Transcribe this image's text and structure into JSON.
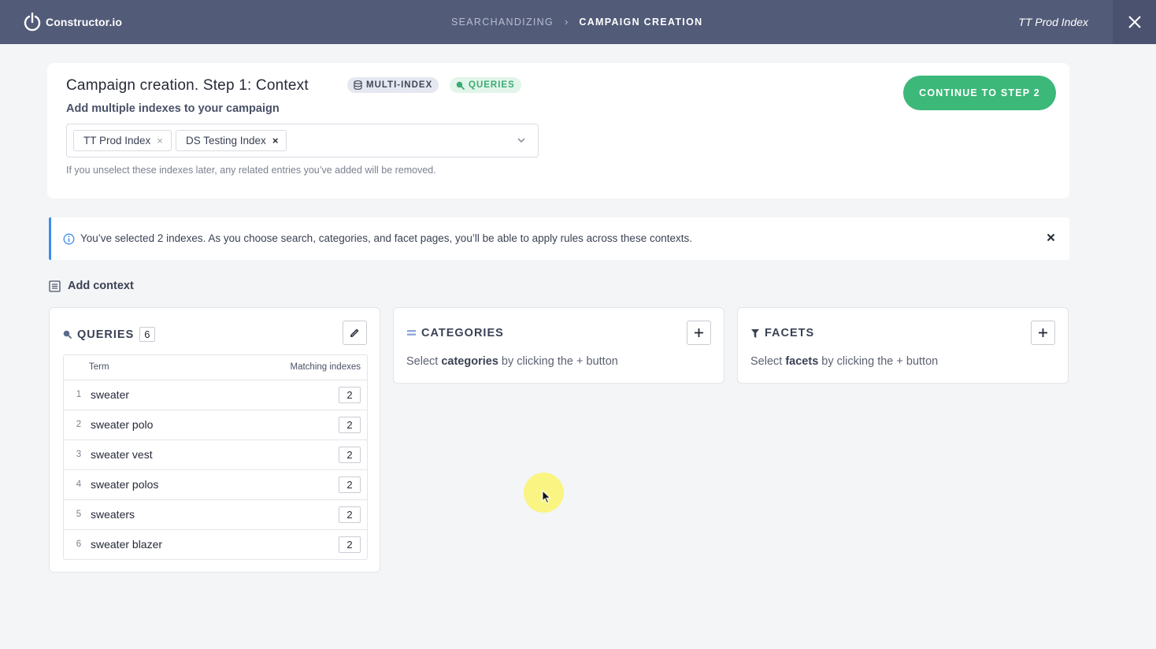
{
  "topbar": {
    "logo_text": "Constructor.io",
    "breadcrumb": [
      "SEARCHANDIZING",
      "CAMPAIGN CREATION"
    ],
    "breadcrumb_sep": "›",
    "index_name": "TT Prod Index"
  },
  "header": {
    "title": "Campaign creation. Step 1: Context",
    "badges": [
      {
        "label": "MULTI-INDEX",
        "icon": "database-icon"
      },
      {
        "label": "QUERIES",
        "icon": "search-icon"
      }
    ],
    "subtitle": "Add multiple indexes to your campaign",
    "selected_indexes": [
      "TT Prod Index",
      "DS Testing Index"
    ],
    "chip_remove": "×",
    "helper_text": "If you unselect these indexes later, any related entries you’ve added will be removed.",
    "continue_label": "CONTINUE TO STEP 2"
  },
  "banner": {
    "text": "You’ve selected 2 indexes. As you choose search, categories, and facet pages, you’ll be able to apply rules across these contexts."
  },
  "add_context": {
    "label": "Add context"
  },
  "queries_panel": {
    "title": "QUERIES",
    "count": "6",
    "columns": {
      "term": "Term",
      "matching": "Matching indexes"
    },
    "rows": [
      {
        "num": "1",
        "term": "sweater",
        "matching": "2"
      },
      {
        "num": "2",
        "term": "sweater polo",
        "matching": "2"
      },
      {
        "num": "3",
        "term": "sweater vest",
        "matching": "2"
      },
      {
        "num": "4",
        "term": "sweater polos",
        "matching": "2"
      },
      {
        "num": "5",
        "term": "sweaters",
        "matching": "2"
      },
      {
        "num": "6",
        "term": "sweater blazer",
        "matching": "2"
      }
    ]
  },
  "categories_panel": {
    "title": "CATEGORIES",
    "empty_pre": "Select ",
    "empty_bold": "categories",
    "empty_post": " by clicking the + button"
  },
  "facets_panel": {
    "title": "FACETS",
    "empty_pre": "Select ",
    "empty_bold": "facets",
    "empty_post": " by clicking the + button"
  },
  "colors": {
    "topbar": "#525b78",
    "accent_green": "#3cb879",
    "info_blue": "#3c8ce7",
    "badge_green_text": "#3bab74"
  }
}
